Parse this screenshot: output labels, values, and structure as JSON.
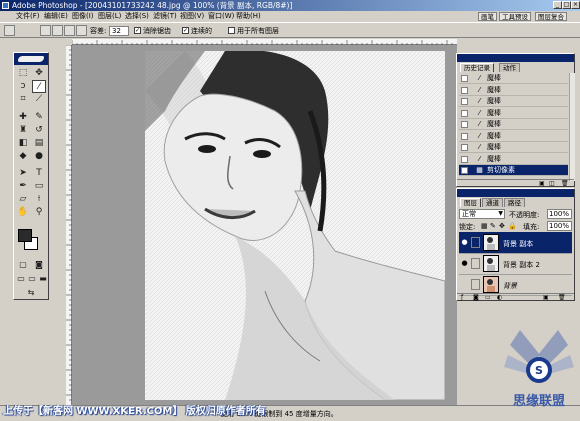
{
  "window": {
    "title": "Adobe Photoshop - [20043101733242 48.jpg @ 100% (背景 副本, RGB/8#)]",
    "buttons": [
      "_",
      "□",
      "×"
    ]
  },
  "menu": {
    "items": [
      "文件(F)",
      "编辑(E)",
      "图像(I)",
      "图层(L)",
      "选择(S)",
      "滤镜(T)",
      "视图(V)",
      "窗口(W)",
      "帮助(H)"
    ],
    "palette_tabs": [
      "画笔",
      "工具预设",
      "图层复合"
    ]
  },
  "options": {
    "tolerance_label": "容差:",
    "tolerance_value": "32",
    "antialias_label": "消除锯齿",
    "antialias_checked": true,
    "contiguous_label": "连续的",
    "contiguous_checked": true,
    "all_layers_label": "用于所有图层",
    "all_layers_checked": false
  },
  "history": {
    "tabs": [
      "历史记录",
      "动作"
    ],
    "items": [
      {
        "label": "魔棒",
        "icon": "magic-wand-icon"
      },
      {
        "label": "魔棒",
        "icon": "magic-wand-icon"
      },
      {
        "label": "魔棒",
        "icon": "magic-wand-icon"
      },
      {
        "label": "魔棒",
        "icon": "magic-wand-icon"
      },
      {
        "label": "魔棒",
        "icon": "magic-wand-icon"
      },
      {
        "label": "魔棒",
        "icon": "magic-wand-icon"
      },
      {
        "label": "魔棒",
        "icon": "magic-wand-icon"
      },
      {
        "label": "魔棒",
        "icon": "magic-wand-icon"
      },
      {
        "label": "剪切像素",
        "icon": "cut-pixels-icon",
        "selected": true
      }
    ]
  },
  "layers": {
    "tabs": [
      "图层",
      "通道",
      "路径"
    ],
    "blend_mode": "正常",
    "opacity_label": "不透明度:",
    "opacity_value": "100%",
    "lock_label": "锁定:",
    "fill_label": "填充:",
    "fill_value": "100%",
    "items": [
      {
        "name": "背景 副本",
        "selected": true,
        "visible": true
      },
      {
        "name": "背景 副本 2",
        "selected": false,
        "visible": true
      },
      {
        "name": "背景",
        "selected": false,
        "visible": false
      }
    ]
  },
  "status": {
    "hint": "使用 Shift 键限制到 45 度增量方向。"
  },
  "watermark": {
    "text": "上传于【新客网 WWW.XKER.COM】 版权归原作者所有"
  },
  "logo": {
    "text": "思缘联盟"
  },
  "colors": {
    "accent": "#0a246a",
    "chrome": "#d4d0c8",
    "canvas_bg": "#9a9a9a"
  }
}
